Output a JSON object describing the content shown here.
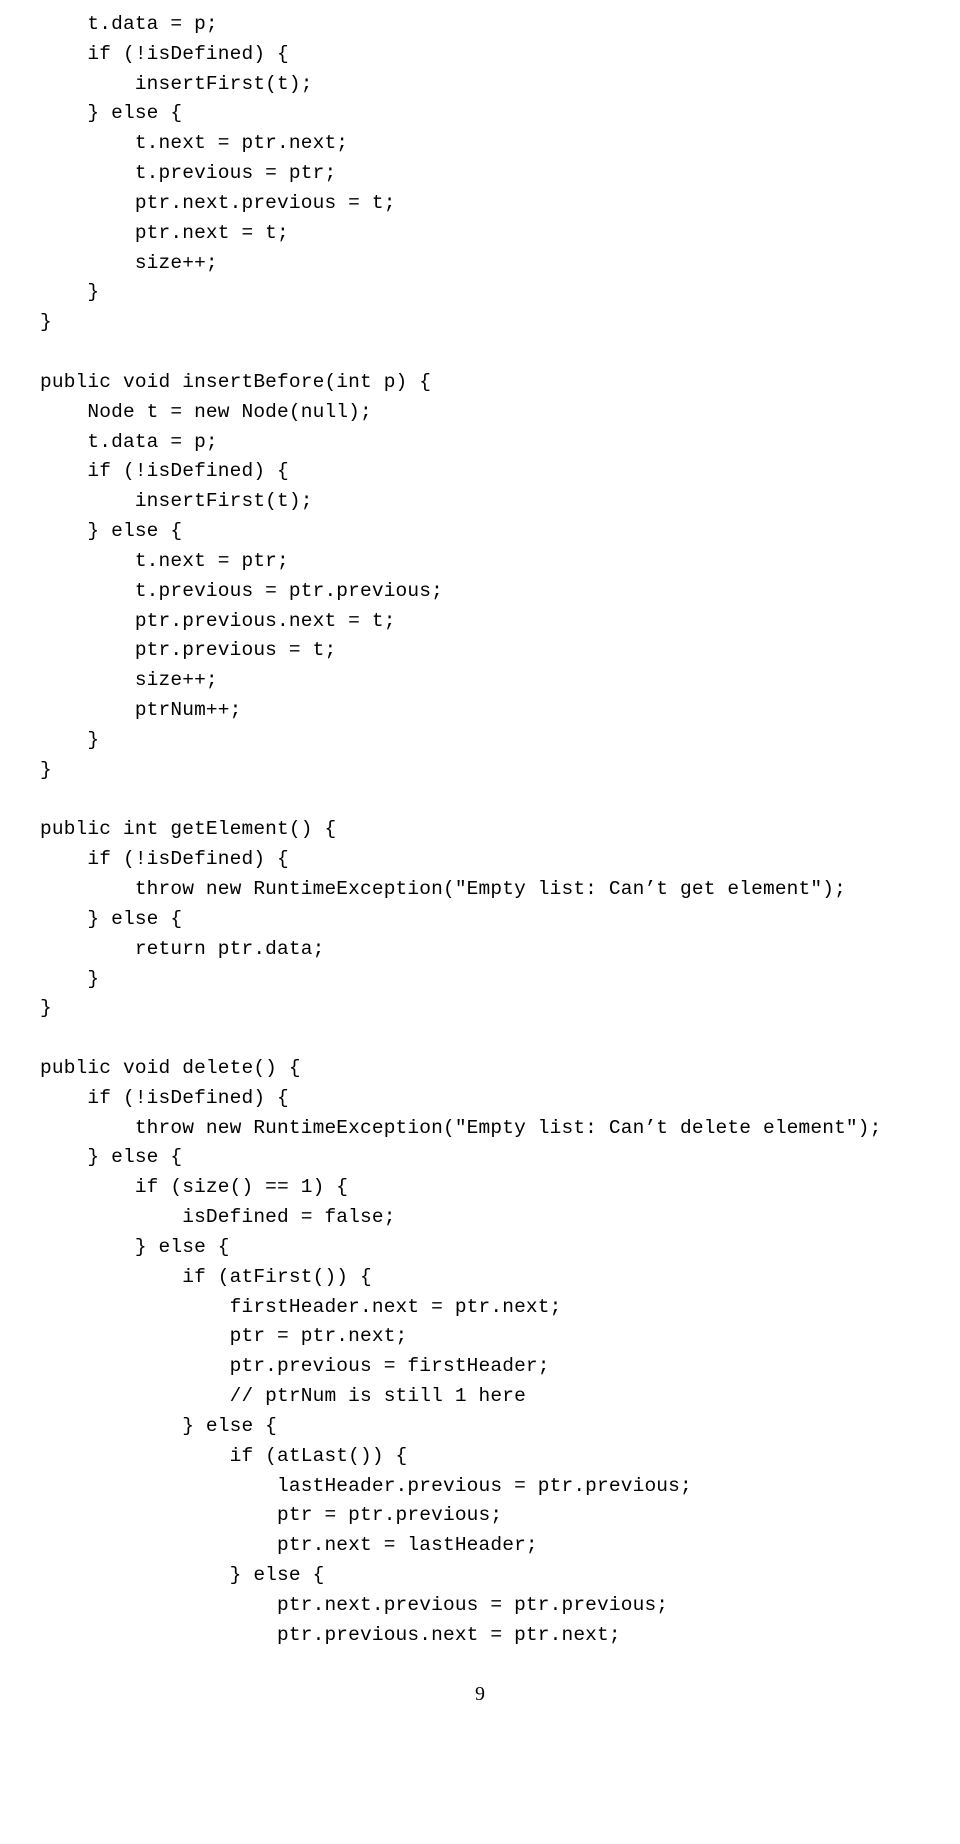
{
  "code": {
    "lines": [
      "    t.data = p;",
      "    if (!isDefined) {",
      "        insertFirst(t);",
      "    } else {",
      "        t.next = ptr.next;",
      "        t.previous = ptr;",
      "        ptr.next.previous = t;",
      "        ptr.next = t;",
      "        size++;",
      "    }",
      "}",
      "",
      "public void insertBefore(int p) {",
      "    Node t = new Node(null);",
      "    t.data = p;",
      "    if (!isDefined) {",
      "        insertFirst(t);",
      "    } else {",
      "        t.next = ptr;",
      "        t.previous = ptr.previous;",
      "        ptr.previous.next = t;",
      "        ptr.previous = t;",
      "        size++;",
      "        ptrNum++;",
      "    }",
      "}",
      "",
      "public int getElement() {",
      "    if (!isDefined) {",
      "        throw new RuntimeException(\"Empty list: Can’t get element\");",
      "    } else {",
      "        return ptr.data;",
      "    }",
      "}",
      "",
      "public void delete() {",
      "    if (!isDefined) {",
      "        throw new RuntimeException(\"Empty list: Can’t delete element\");",
      "    } else {",
      "        if (size() == 1) {",
      "            isDefined = false;",
      "        } else {",
      "            if (atFirst()) {",
      "                firstHeader.next = ptr.next;",
      "                ptr = ptr.next;",
      "                ptr.previous = firstHeader;",
      "                // ptrNum is still 1 here",
      "            } else {",
      "                if (atLast()) {",
      "                    lastHeader.previous = ptr.previous;",
      "                    ptr = ptr.previous;",
      "                    ptr.next = lastHeader;",
      "                } else {",
      "                    ptr.next.previous = ptr.previous;",
      "                    ptr.previous.next = ptr.next;"
    ]
  },
  "page_number": "9"
}
